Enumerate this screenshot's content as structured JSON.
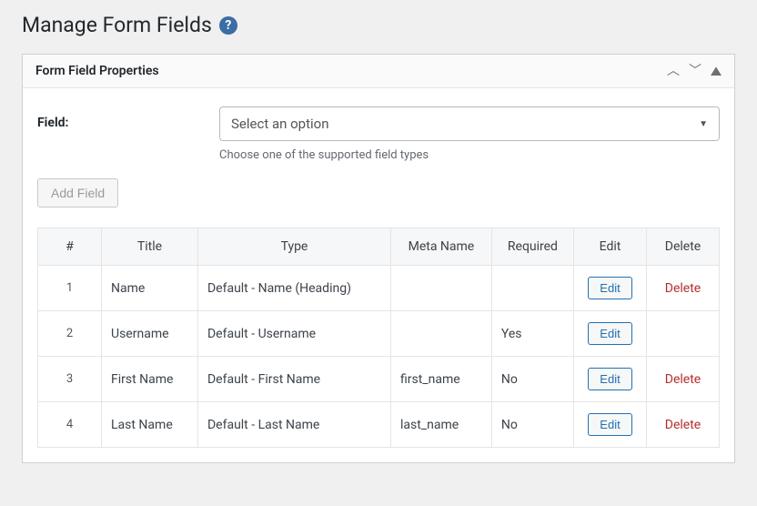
{
  "page": {
    "title": "Manage Form Fields"
  },
  "panel": {
    "title": "Form Field Properties"
  },
  "field_selector": {
    "label": "Field:",
    "placeholder": "Select an option",
    "description": "Choose one of the supported field types"
  },
  "buttons": {
    "add_field": "Add Field",
    "edit": "Edit",
    "delete": "Delete"
  },
  "table": {
    "headers": {
      "index": "#",
      "title": "Title",
      "type": "Type",
      "meta_name": "Meta Name",
      "required": "Required",
      "edit": "Edit",
      "delete": "Delete"
    },
    "rows": [
      {
        "index": "1",
        "title": "Name",
        "type": "Default - Name (Heading)",
        "meta_name": "",
        "required": "",
        "deletable": true
      },
      {
        "index": "2",
        "title": "Username",
        "type": "Default - Username",
        "meta_name": "",
        "required": "Yes",
        "deletable": false
      },
      {
        "index": "3",
        "title": "First Name",
        "type": "Default - First Name",
        "meta_name": "first_name",
        "required": "No",
        "deletable": true
      },
      {
        "index": "4",
        "title": "Last Name",
        "type": "Default - Last Name",
        "meta_name": "last_name",
        "required": "No",
        "deletable": true
      }
    ]
  }
}
